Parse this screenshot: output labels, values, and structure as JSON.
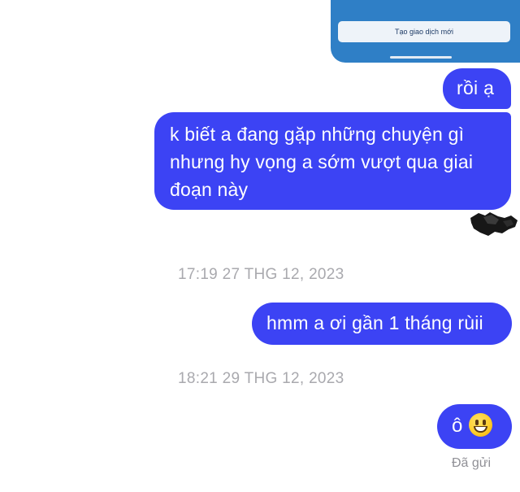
{
  "conversation": {
    "shared_image": {
      "button_label": "Tạo giao dịch mới"
    },
    "messages": [
      {
        "text": "rồi ạ"
      },
      {
        "text": "k biết a đang gặp những chuyện gì nhưng hy vọng a sớm vượt qua giai đoạn này"
      },
      {
        "text": "hmm a ơi gần 1 tháng rùii"
      },
      {
        "text": "ô",
        "emoji": "grinning-face"
      }
    ],
    "timestamps": [
      "17:19 27 THG 12, 2023",
      "18:21 29 THG 12, 2023"
    ],
    "status": "Đã gửi"
  },
  "colors": {
    "sent_bubble": "#3c43f4",
    "timestamp_text": "#a9a9ae",
    "image_background": "#2f7fc6"
  }
}
